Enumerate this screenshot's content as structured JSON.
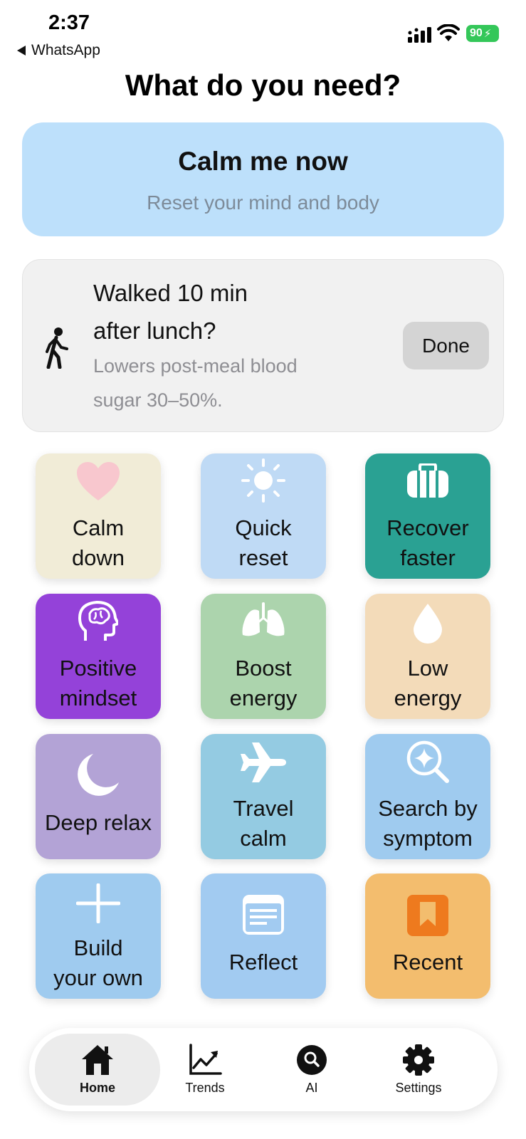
{
  "status_bar": {
    "time": "2:37",
    "back_app": "WhatsApp",
    "battery": "90"
  },
  "title": "What do you need?",
  "calm_card": {
    "title": "Calm me now",
    "subtitle": "Reset your mind and body",
    "color": "#bde0fb"
  },
  "walk_card": {
    "title_line1": "Walked 10 min",
    "title_line2": "after lunch?",
    "subtitle_line1": "Lowers post-meal blood",
    "subtitle_line2": "sugar 30–50%.",
    "button": "Done",
    "icon": "walking-person-icon"
  },
  "tiles": [
    {
      "line1": "Calm",
      "line2": "down",
      "icon": "heart-icon",
      "bg": "#f1ecd7"
    },
    {
      "line1": "Quick",
      "line2": "reset",
      "icon": "sun-icon",
      "bg": "#bfdaf5"
    },
    {
      "line1": "Recover",
      "line2": "faster",
      "icon": "bag-icon",
      "bg": "#2aa193"
    },
    {
      "line1": "Positive",
      "line2": "mindset",
      "icon": "brain-icon",
      "bg": "#9442d9"
    },
    {
      "line1": "Boost",
      "line2": "energy",
      "icon": "lungs-icon",
      "bg": "#acd4ad"
    },
    {
      "line1": "Low",
      "line2": "energy",
      "icon": "drop-icon",
      "bg": "#f3dbb9"
    },
    {
      "line1": "Deep relax",
      "line2": "",
      "icon": "moon-icon",
      "bg": "#b3a3d6"
    },
    {
      "line1": "Travel",
      "line2": "calm",
      "icon": "airplane-icon",
      "bg": "#94cbe2"
    },
    {
      "line1": "Search by",
      "line2": "symptom",
      "icon": "search-sparkle-icon",
      "bg": "#9fcbef"
    },
    {
      "line1": "Build",
      "line2": "your own",
      "icon": "plus-icon",
      "bg": "#9fcbef"
    },
    {
      "line1": "Reflect",
      "line2": "",
      "icon": "journal-icon",
      "bg": "#a2cbf1"
    },
    {
      "line1": "Recent",
      "line2": "",
      "icon": "bookmark-icon",
      "bg": "#f3bd6e"
    }
  ],
  "nav": {
    "items": [
      {
        "label": "Home",
        "icon": "home-icon",
        "active": true
      },
      {
        "label": "Trends",
        "icon": "trend-chart-icon",
        "active": false
      },
      {
        "label": "AI",
        "icon": "ai-search-icon",
        "active": false
      },
      {
        "label": "Settings",
        "icon": "gear-icon",
        "active": false
      }
    ]
  }
}
